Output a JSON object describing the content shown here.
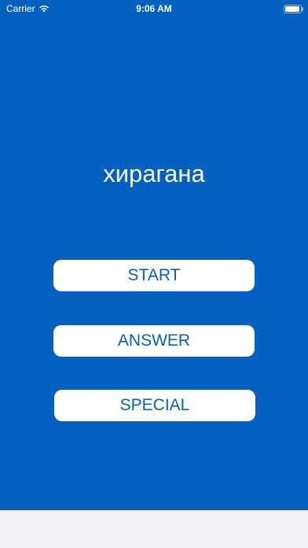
{
  "status_bar": {
    "carrier": "Carrier",
    "time": "9:06 AM",
    "icons": [
      "wifi-icon",
      "battery-icon"
    ]
  },
  "main": {
    "title": "хирагана",
    "buttons": [
      {
        "label": "START"
      },
      {
        "label": "ANSWER"
      },
      {
        "label": "SPECIAL"
      }
    ]
  },
  "colors": {
    "background": "#0461bf",
    "button_bg": "#ffffff",
    "button_text": "#0461bf",
    "bottom_area": "#f0f0f5"
  }
}
